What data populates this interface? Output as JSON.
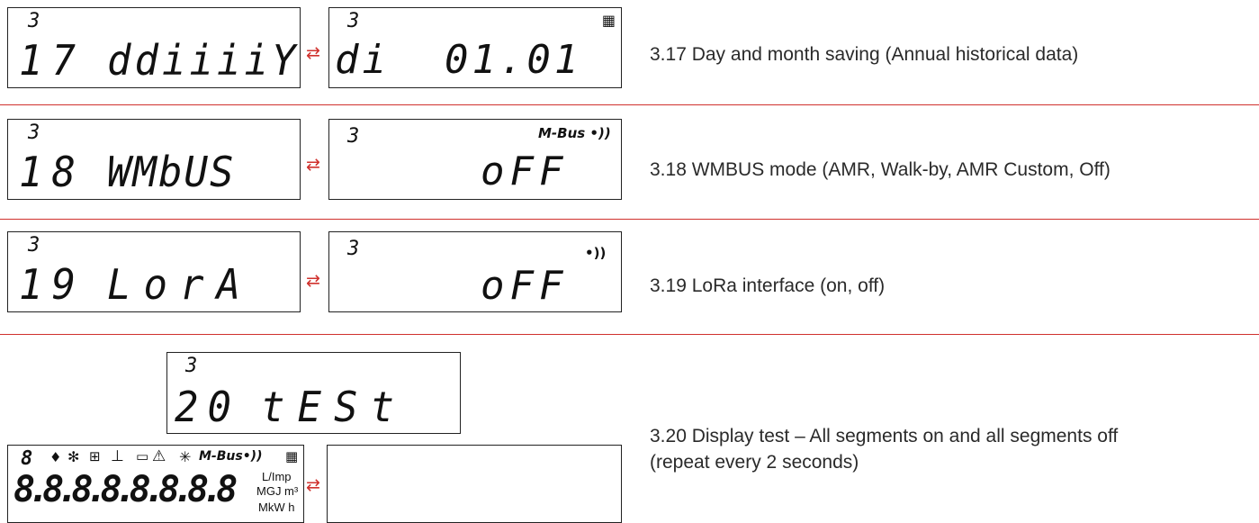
{
  "rows": [
    {
      "index": "3",
      "code": "17",
      "label_text": "ddiiiiY",
      "value_index": "",
      "value_text": "di  01.01",
      "value_icon": "calendar-icon",
      "description": "3.17 Day and month saving (Annual historical data)"
    },
    {
      "index": "3",
      "code": "18",
      "label_text": "WMbUS",
      "value_index": "3",
      "value_text": "oFF",
      "value_icon": "mbus-icon",
      "icon_text": "M-Bus",
      "description": "3.18 WMBUS mode (AMR, Walk-by, AMR Custom, Off)"
    },
    {
      "index": "3",
      "code": "19",
      "label_text": "LorA",
      "value_index": "3",
      "value_text": "oFF",
      "value_icon": "radio-icon",
      "description": "3.19 LoRa interface (on, off)"
    }
  ],
  "test": {
    "index": "3",
    "code": "20",
    "label_text": "tESt",
    "all_on_digits": "8.8.8.8.8.8.8.8",
    "all_on_small_digit": "8",
    "unit_line1": "L/Imp",
    "unit_line2": "MGJ m³",
    "unit_line3": "MkW h",
    "mbus_text": "M-Bus",
    "description_line1": "3.20 Display test – All segments on and all segments off",
    "description_line2": "(repeat every 2 seconds)"
  },
  "arrow_glyph": "⇄",
  "colors": {
    "accent": "#d0312d",
    "text": "#2a2a2a",
    "lcd_border": "#222222"
  }
}
